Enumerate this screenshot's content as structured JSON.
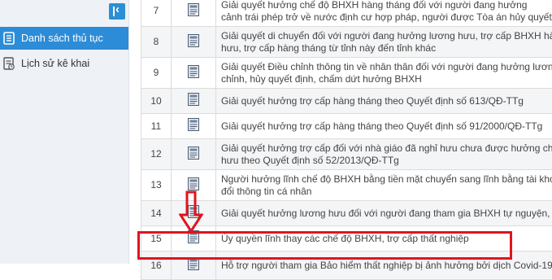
{
  "sidebar": {
    "collapse_icon": "collapse-left-icon",
    "items": [
      {
        "label": "Danh sách thủ tục",
        "icon": "list-icon",
        "active": true
      },
      {
        "label": "Lịch sử kê khai",
        "icon": "history-icon",
        "active": false
      }
    ]
  },
  "table": {
    "rows": [
      {
        "num": "7",
        "text_lines": [
          "Giải quyết hưởng chế độ BHXH hàng tháng đối với người đang hưởng",
          "cảnh trái phép trở về nước định cư hợp pháp, người được Tòa án hủy quyết định tuyên"
        ]
      },
      {
        "num": "8",
        "text_lines": [
          "Giải quyết di chuyển đối với người đang hưởng lương hưu, trợ cấp BHXH hàng tháng v",
          "hưu, trợ cấp hàng tháng từ tỉnh này đến tỉnh khác"
        ]
      },
      {
        "num": "9",
        "text_lines": [
          "Giải quyết Điều chỉnh thông tin về nhân thân đối với người đang hưởng lương hưu, trợ c",
          "chỉnh, hủy quyết định, chấm dứt hưởng BHXH"
        ]
      },
      {
        "num": "10",
        "text_lines": [
          "Giải quyết hưởng trợ cấp hàng tháng theo Quyết định số 613/QĐ-TTg"
        ]
      },
      {
        "num": "11",
        "text_lines": [
          "Giải quyết hưởng trợ cấp hàng tháng theo Quyết định số 91/2000/QĐ-TTg"
        ]
      },
      {
        "num": "12",
        "text_lines": [
          "Giải quyết hưởng trợ cấp đối với nhà giáo đã nghỉ hưu chưa được hưởng chế độ phụ cấ",
          "hưu theo Quyết định số 52/2013/QĐ-TTg"
        ]
      },
      {
        "num": "13",
        "text_lines": [
          "Người hưởng lĩnh chế độ BHXH bằng tiền mặt chuyển sang lĩnh bằng tài khoản cá nhân",
          "đổi thông tin cá nhân"
        ]
      },
      {
        "num": "14",
        "text_lines": [
          "Giải quyết hưởng lương hưu đối với người đang tham gia BHXH tự nguyện, người bảo l"
        ]
      },
      {
        "num": "15",
        "text_lines": [
          "Ủy quyền lĩnh thay các chế độ BHXH, trợ cấp thất nghiệp"
        ]
      },
      {
        "num": "16",
        "text_lines": [
          "Hỗ trợ người tham gia Bảo hiểm thất nghiệp bị ảnh hưởng bởi dịch Covid-19"
        ]
      }
    ],
    "row_icon": "document-icon"
  },
  "colors": {
    "accent": "#2d8cd7",
    "highlight": "#e0141e",
    "sidebar_bg": "#eef1f5"
  }
}
